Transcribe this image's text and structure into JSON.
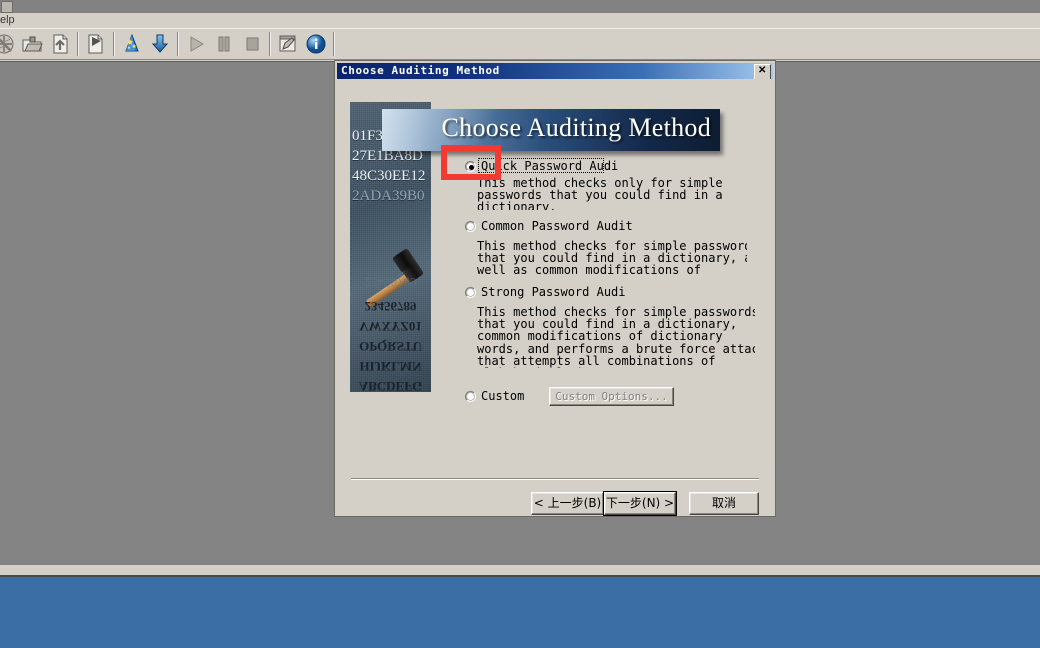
{
  "app": {
    "menu": {
      "help_label": "elp"
    },
    "toolbar": {
      "items": [
        {
          "name": "new-icon",
          "title": "New"
        },
        {
          "name": "open-folder-icon",
          "title": "Open"
        },
        {
          "name": "save-icon",
          "title": "Save"
        },
        {
          "name": "export-icon",
          "title": "Export"
        },
        {
          "name": "wizard-hat-icon",
          "title": "Audit Wizard"
        },
        {
          "name": "download-icon",
          "title": "Import"
        },
        {
          "name": "play-icon",
          "title": "Start"
        },
        {
          "name": "pause-icon",
          "title": "Pause"
        },
        {
          "name": "stop-icon",
          "title": "Stop"
        },
        {
          "name": "report-icon",
          "title": "Report"
        },
        {
          "name": "info-icon",
          "title": "About"
        }
      ]
    }
  },
  "dialog": {
    "title": "Choose Auditing Method",
    "close_label": "✕",
    "banner_text": "Choose Auditing Method",
    "sidepic": {
      "hex_lines": [
        "01F3D68C6A",
        "27E1BA8D",
        "48C30EE12",
        "2ADA39B0"
      ],
      "alphabet_lines": [
        "ABCDEFG",
        "HIJKLMN",
        "OPQRSTU",
        "VWXYZ01",
        "23456789"
      ]
    },
    "options": [
      {
        "id": "quick",
        "label": "Quick Password Audi",
        "label_accel": "Q",
        "selected": true,
        "focused": true,
        "description": "This method checks only for simple\npasswords that you could find in a\ndictionary."
      },
      {
        "id": "common",
        "label": "Common Password Audit",
        "label_accel": "C",
        "selected": false,
        "focused": false,
        "description": "This method checks for simple passwords\nthat you could find in a dictionary, as\nwell as common modifications of\ndictionary words."
      },
      {
        "id": "strong",
        "label": "Strong Password Audi",
        "label_accel": "S",
        "selected": false,
        "focused": false,
        "description": "This method checks for simple passwords\nthat you could find in a dictionary,\ncommon modifications of dictionary\nwords, and performs a brute force attack\nthat attempts all combinations of\nalphabetical characters."
      },
      {
        "id": "custom",
        "label": "Custom",
        "label_accel": "u",
        "selected": false,
        "focused": false,
        "description": ""
      }
    ],
    "custom_options_button": "Custom Options...",
    "buttons": {
      "back": "< 上一步(B)",
      "next": "下一步(N) >",
      "cancel": "取消"
    }
  },
  "annotation": {
    "type": "highlight-box",
    "color": "#f23a32"
  }
}
